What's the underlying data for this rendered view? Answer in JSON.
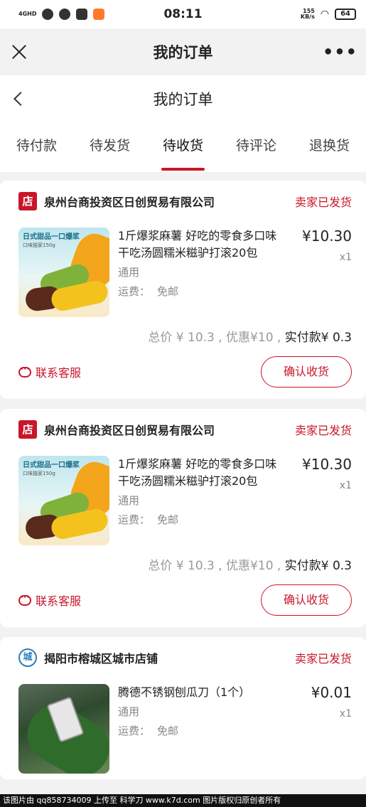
{
  "status_bar": {
    "network": "4GHD",
    "time": "08:11",
    "speed_value": "155",
    "speed_unit": "KB/s",
    "battery": "64"
  },
  "appbar": {
    "title": "我的订单",
    "more": "•••"
  },
  "page": {
    "title": "我的订单"
  },
  "tabs": [
    {
      "label": "待付款"
    },
    {
      "label": "待发货"
    },
    {
      "label": "待收货",
      "active": true
    },
    {
      "label": "待评论"
    },
    {
      "label": "退换货"
    }
  ],
  "orders": [
    {
      "shop_icon": "店",
      "shop": "泉州台商投资区日创贸易有限公司",
      "status": "卖家已发货",
      "product": "1斤爆浆麻薯 好吃的零食多口味干吃汤圆糯米糍驴打滚20包",
      "thumb_tag": "日式甜品一口爆浆",
      "thumb_sub": "口味独家150g",
      "spec": "通用",
      "shipping_label": "运费：",
      "shipping_value": "免邮",
      "price": "¥10.30",
      "qty": "x1",
      "total_text": "总价 ¥ 10.3 , 优惠¥10 , ",
      "paid_text": "实付款¥ 0.3",
      "service": "联系客服",
      "confirm": "确认收货"
    },
    {
      "shop_icon": "店",
      "shop": "泉州台商投资区日创贸易有限公司",
      "status": "卖家已发货",
      "product": "1斤爆浆麻薯 好吃的零食多口味干吃汤圆糯米糍驴打滚20包",
      "thumb_tag": "日式甜品一口爆浆",
      "thumb_sub": "口味独家150g",
      "spec": "通用",
      "shipping_label": "运费：",
      "shipping_value": "免邮",
      "price": "¥10.30",
      "qty": "x1",
      "total_text": "总价 ¥ 10.3 , 优惠¥10 , ",
      "paid_text": "实付款¥ 0.3",
      "service": "联系客服",
      "confirm": "确认收货"
    },
    {
      "shop_icon": "城",
      "shop": "揭阳市榕城区城市店铺",
      "status": "卖家已发货",
      "product": "腾德不锈钢刨瓜刀（1个）",
      "spec": "通用",
      "shipping_label": "运费：",
      "shipping_value": "免邮",
      "price": "¥0.01",
      "qty": "x1"
    }
  ],
  "watermark": "该图片由 qq858734009 上传至 科学刀 www.k7d.com 图片版权归原创者所有",
  "colors": {
    "accent": "#c8162a",
    "background": "#f2f2f2"
  }
}
